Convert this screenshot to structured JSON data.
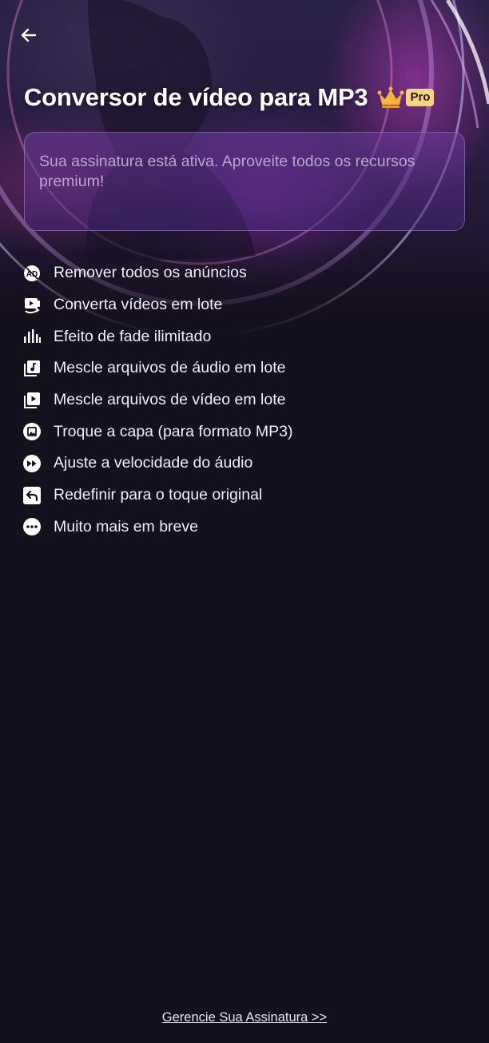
{
  "header": {
    "back_icon": "arrow-left-icon",
    "title": "Conversor de vídeo para MP3",
    "crown_icon": "crown-icon",
    "badge": "Pro"
  },
  "status_card": {
    "text": "Sua assinatura está ativa. Aproveite todos os recursos premium!"
  },
  "features": [
    {
      "icon": "ad-icon",
      "label": "Remover todos os anúncios"
    },
    {
      "icon": "batch-video-convert-icon",
      "label": "Converta vídeos em lote"
    },
    {
      "icon": "equalizer-bars-icon",
      "label": "Efeito de fade ilimitado"
    },
    {
      "icon": "audio-library-icon",
      "label": "Mescle arquivos de áudio em lote"
    },
    {
      "icon": "video-library-icon",
      "label": "Mescle arquivos de vídeo em lote"
    },
    {
      "icon": "image-cover-icon",
      "label": "Troque a capa (para formato MP3)"
    },
    {
      "icon": "fast-forward-icon",
      "label": "Ajuste a velocidade do áudio"
    },
    {
      "icon": "reset-arrow-icon",
      "label": "Redefinir para o toque original"
    },
    {
      "icon": "more-dots-icon",
      "label": "Muito mais em breve"
    }
  ],
  "footer": {
    "manage_link": "Gerencie Sua Assinatura >>"
  },
  "colors": {
    "background": "#15101d",
    "badge": "#f7d38a",
    "crown": "#f5b342",
    "card_border": "#be96e6"
  }
}
